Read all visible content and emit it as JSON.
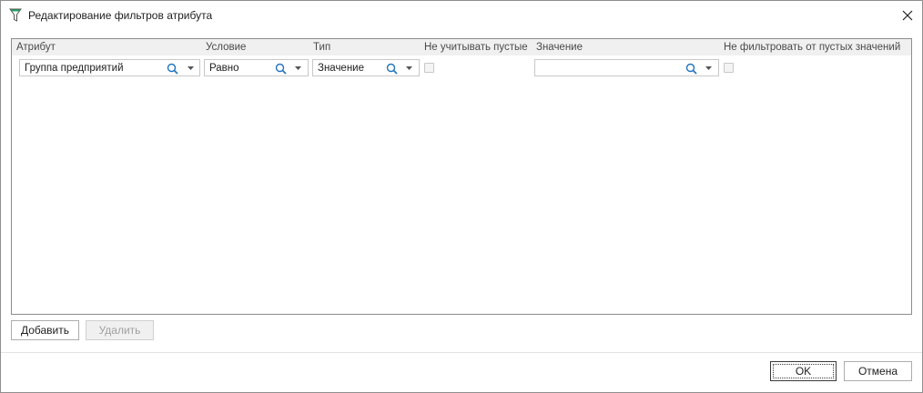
{
  "window": {
    "title": "Редактирование фильтров атрибута"
  },
  "grid": {
    "columns": [
      "Атрибут",
      "Условие",
      "Тип",
      "Не учитывать пустые",
      "Значение",
      "Не фильтровать от пустых значений"
    ],
    "rows": [
      {
        "attribute": "Группа предприятий",
        "condition": "Равно",
        "type": "Значение",
        "ignore_empty": false,
        "value": "",
        "no_filter_empty": false
      }
    ]
  },
  "buttons": {
    "add": "Добавить",
    "delete": "Удалить",
    "ok": "OK",
    "cancel": "Отмена"
  },
  "icons": {
    "title": "filter-funnel-icon",
    "close": "close-icon",
    "search": "search-icon",
    "dropdown": "chevron-down-icon"
  },
  "colors": {
    "funnel_top": "#21a366",
    "search_icon": "#1e73be",
    "header_bg": "#f0f0f0"
  }
}
